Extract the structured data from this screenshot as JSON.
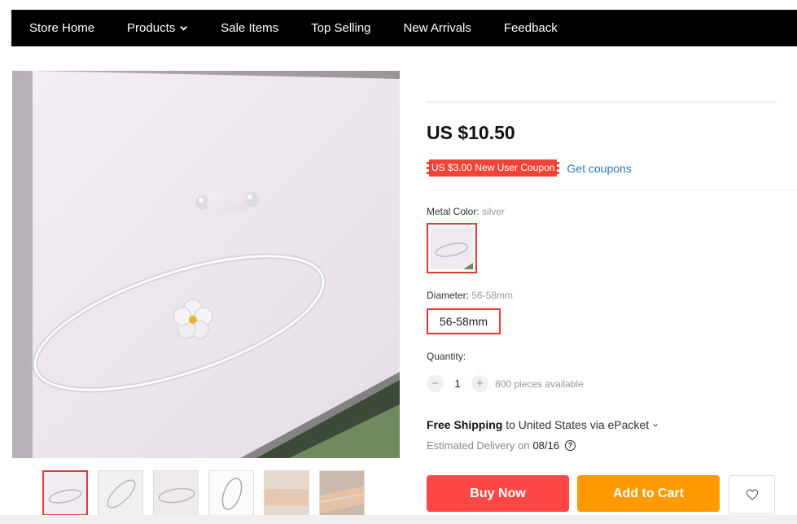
{
  "nav": {
    "items": [
      {
        "label": "Store Home"
      },
      {
        "label": "Products"
      },
      {
        "label": "Sale Items"
      },
      {
        "label": "Top Selling"
      },
      {
        "label": "New Arrivals"
      },
      {
        "label": "Feedback"
      }
    ]
  },
  "product": {
    "price": "US $10.50",
    "coupon_label": "US $3.00 New User Coupon",
    "get_coupons": "Get coupons",
    "metal_color_label": "Metal Color:",
    "metal_color_value": "silver",
    "diameter_label": "Diameter:",
    "diameter_value": "56-58mm",
    "diameter_option": "56-58mm",
    "quantity_label": "Quantity:",
    "quantity_value": "1",
    "quantity_minus": "−",
    "quantity_plus": "+",
    "available": "800 pieces available",
    "shipping_free": "Free Shipping",
    "shipping_rest": "to United States via ePacket",
    "delivery_label": "Estimated Delivery on",
    "delivery_date": "08/16",
    "buy_now": "Buy Now",
    "add_to_cart": "Add to Cart"
  },
  "colors": {
    "nav_bg": "#000000",
    "buy_now": "#ff4747",
    "add_to_cart": "#ff9a00",
    "coupon": "#f44336",
    "link": "#2a7ab6",
    "selected_border": "#e53935"
  },
  "icons": {
    "products_dropdown": "chevron-down-icon",
    "shipping_dropdown": "chevron-down-icon",
    "delivery_help": "question-circle-icon",
    "wishlist": "heart-icon"
  }
}
